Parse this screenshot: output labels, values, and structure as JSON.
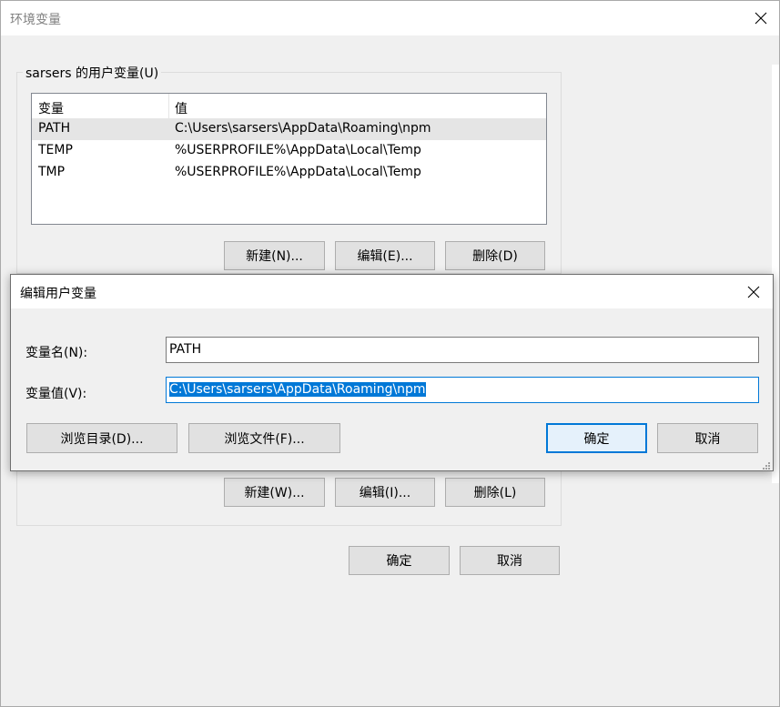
{
  "window": {
    "title": "环境变量"
  },
  "user_vars": {
    "group_label": "sarsers 的用户变量(U)",
    "columns": [
      "变量",
      "值"
    ],
    "rows": [
      {
        "name": "PATH",
        "value": "C:\\Users\\sarsers\\AppData\\Roaming\\npm"
      },
      {
        "name": "TEMP",
        "value": "%USERPROFILE%\\AppData\\Local\\Temp"
      },
      {
        "name": "TMP",
        "value": "%USERPROFILE%\\AppData\\Local\\Temp"
      }
    ],
    "buttons": {
      "new": "新建(N)...",
      "edit": "编辑(E)...",
      "delete": "删除(D)"
    }
  },
  "system_vars": {
    "buttons": {
      "new": "新建(W)...",
      "edit": "编辑(I)...",
      "delete": "删除(L)"
    }
  },
  "footer": {
    "ok": "确定",
    "cancel": "取消"
  },
  "dialog": {
    "title": "编辑用户变量",
    "name_label": "变量名(N):",
    "name_value": "PATH",
    "value_label": "变量值(V):",
    "value_value": "C:\\Users\\sarsers\\AppData\\Roaming\\npm",
    "browse_dir": "浏览目录(D)...",
    "browse_file": "浏览文件(F)...",
    "ok": "确定",
    "cancel": "取消"
  },
  "colors": {
    "accent": "#0078d7",
    "window_bg": "#f0f0f0",
    "button_bg": "#e1e1e1",
    "row_highlight": "#e5e5e5"
  },
  "icons": {
    "close": "close-icon",
    "resize": "resize-grip-icon"
  }
}
